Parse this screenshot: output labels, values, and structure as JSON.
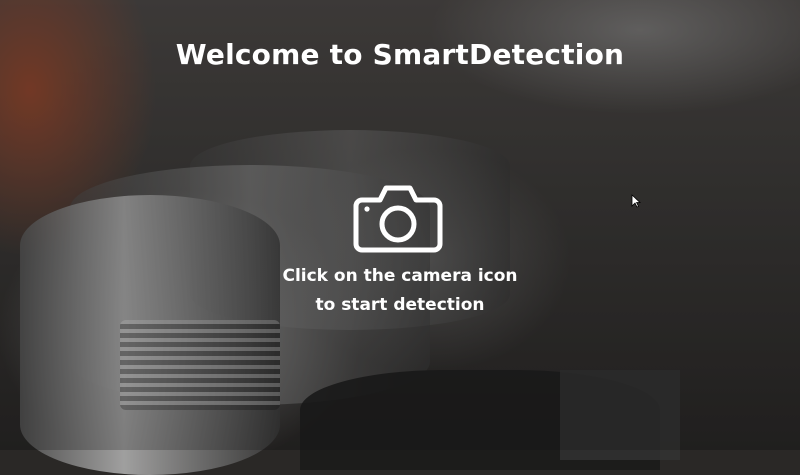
{
  "header": {
    "title": "Welcome to SmartDetection"
  },
  "camera_button": {
    "icon": "camera-icon"
  },
  "instructions": {
    "line1": "Click on the camera icon",
    "line2": "to start detection"
  },
  "colors": {
    "text": "#ffffff",
    "accent_background": "#a0462a"
  }
}
